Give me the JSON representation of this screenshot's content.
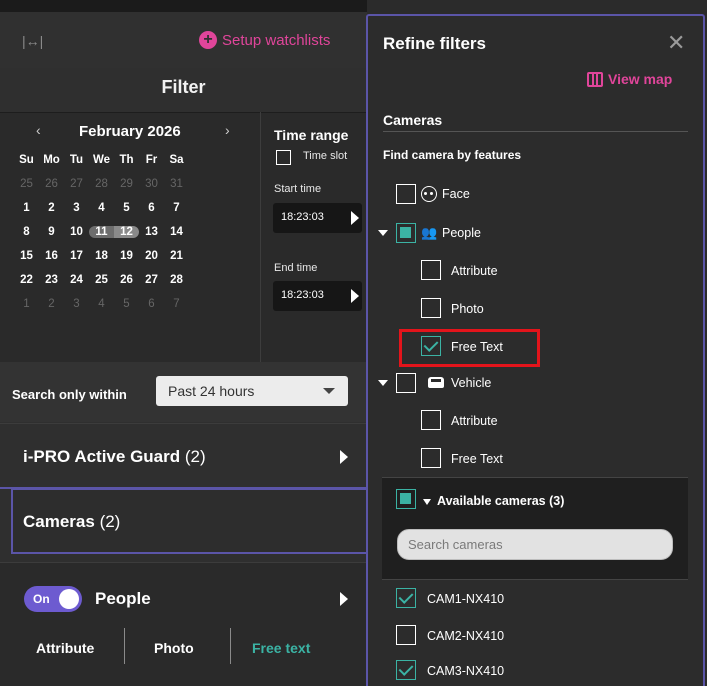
{
  "header": {
    "setup_watchlists": "Setup watchlists",
    "filter_title": "Filter"
  },
  "calendar": {
    "month": "February 2026",
    "weekdays": [
      "Su",
      "Mo",
      "Tu",
      "We",
      "Th",
      "Fr",
      "Sa"
    ],
    "weeks": [
      [
        "25",
        "26",
        "27",
        "28",
        "29",
        "30",
        "31"
      ],
      [
        "1",
        "2",
        "3",
        "4",
        "5",
        "6",
        "7"
      ],
      [
        "8",
        "9",
        "10",
        "11",
        "12",
        "13",
        "14"
      ],
      [
        "15",
        "16",
        "17",
        "18",
        "19",
        "20",
        "21"
      ],
      [
        "22",
        "23",
        "24",
        "25",
        "26",
        "27",
        "28"
      ],
      [
        "1",
        "2",
        "3",
        "4",
        "5",
        "6",
        "7"
      ]
    ],
    "selected": [
      "11",
      "12"
    ]
  },
  "time_range": {
    "title": "Time range",
    "time_slot": "Time slot",
    "start_label": "Start time",
    "start_value": "18:23:03",
    "end_label": "End time",
    "end_value": "18:23:03"
  },
  "search_within": {
    "label": "Search only within",
    "value": "Past 24 hours"
  },
  "sections": {
    "guard_label": "i-PRO Active Guard",
    "guard_count": "(2)",
    "cameras_label": "Cameras",
    "cameras_count": "(2)"
  },
  "people_panel": {
    "toggle": "On",
    "label": "People",
    "tabs": [
      "Attribute",
      "Photo",
      "Free text"
    ],
    "active_tab": "Free text"
  },
  "refine": {
    "title": "Refine filters",
    "close": "✕",
    "view_map": "View map",
    "cameras_heading": "Cameras",
    "find_by_features": "Find camera by features",
    "tree": {
      "face": "Face",
      "people": "People",
      "people_children": [
        "Attribute",
        "Photo",
        "Free Text"
      ],
      "vehicle": "Vehicle",
      "vehicle_children": [
        "Attribute",
        "Free Text"
      ]
    },
    "available_cameras": "Available cameras (3)",
    "search_placeholder": "Search cameras",
    "camera_list": [
      {
        "name": "CAM1-NX410",
        "checked": true
      },
      {
        "name": "CAM2-NX410",
        "checked": false
      },
      {
        "name": "CAM3-NX410",
        "checked": true
      }
    ]
  },
  "colors": {
    "accent_pink": "#e0459a",
    "accent_teal": "#3bb3a4",
    "accent_purple": "#6d5bd0",
    "highlight_red": "#e3141b"
  }
}
